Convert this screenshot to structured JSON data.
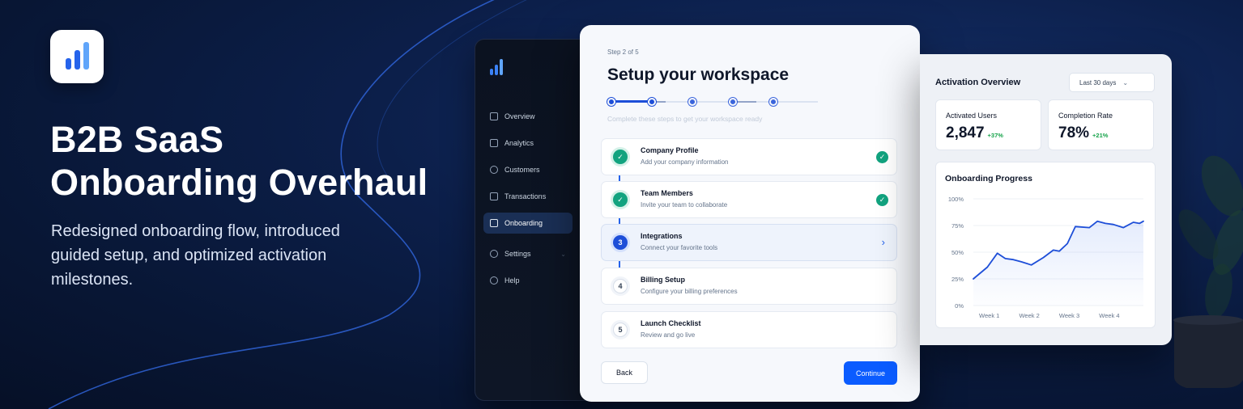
{
  "hero": {
    "title_line1": "B2B SaaS",
    "title_line2": "Onboarding Overhaul",
    "subtitle": "Redesigned onboarding flow, introduced guided setup, and optimized activation milestones."
  },
  "sidebar": {
    "items": [
      {
        "label": "Overview",
        "icon": "overview-icon"
      },
      {
        "label": "Analytics",
        "icon": "analytics-icon"
      },
      {
        "label": "Customers",
        "icon": "customers-icon"
      },
      {
        "label": "Transactions",
        "icon": "transactions-icon"
      },
      {
        "label": "Onboarding",
        "icon": "onboarding-icon",
        "active": true
      },
      {
        "label": "Settings",
        "icon": "settings-icon"
      },
      {
        "label": "Help",
        "icon": "help-icon"
      }
    ]
  },
  "wizard": {
    "step_label": "Step 2 of 5",
    "title": "Setup your workspace",
    "hint": "Complete these steps to get your workspace ready",
    "steps": [
      {
        "number": "1",
        "name": "Company Profile",
        "desc": "Add your company information",
        "status": "done"
      },
      {
        "number": "2",
        "name": "Team Members",
        "desc": "Invite your team to collaborate",
        "status": "done"
      },
      {
        "number": "3",
        "name": "Integrations",
        "desc": "Connect your favorite tools",
        "status": "active"
      },
      {
        "number": "4",
        "name": "Billing Setup",
        "desc": "Configure your billing preferences",
        "status": "todo"
      },
      {
        "number": "5",
        "name": "Launch Checklist",
        "desc": "Review and go live",
        "status": "todo"
      }
    ],
    "back_label": "Back",
    "continue_label": "Continue"
  },
  "analytics": {
    "title": "Activation Overview",
    "range_select": "Last 30 days",
    "stats": [
      {
        "label": "Activated Users",
        "value": "2,847",
        "delta": "+37%"
      },
      {
        "label": "Completion Rate",
        "value": "78%",
        "delta": "+21%"
      }
    ]
  },
  "colors": {
    "accent": "#0b5cff",
    "success": "#12a37f",
    "background": "#0c1f4a"
  },
  "chart_data": {
    "type": "area",
    "title": "Onboarding Progress",
    "categories": [
      "Week 1",
      "Week 2",
      "Week 3",
      "Week 4"
    ],
    "y_ticks": [
      "0%",
      "25%",
      "50%",
      "75%",
      "100%"
    ],
    "ylim": [
      0,
      100
    ],
    "x": [
      0.0,
      0.35,
      0.6,
      0.8,
      1.0,
      1.2,
      1.45,
      1.75,
      2.0,
      2.15,
      2.35,
      2.55,
      2.9,
      3.1,
      3.3,
      3.5,
      3.75,
      4.0,
      4.15,
      4.25
    ],
    "series": [
      {
        "values": [
          25,
          36,
          49,
          44,
          43,
          41,
          38,
          45,
          52,
          51,
          58,
          74,
          73,
          79,
          77,
          76,
          73,
          78,
          77,
          79
        ]
      }
    ],
    "grid": true
  }
}
